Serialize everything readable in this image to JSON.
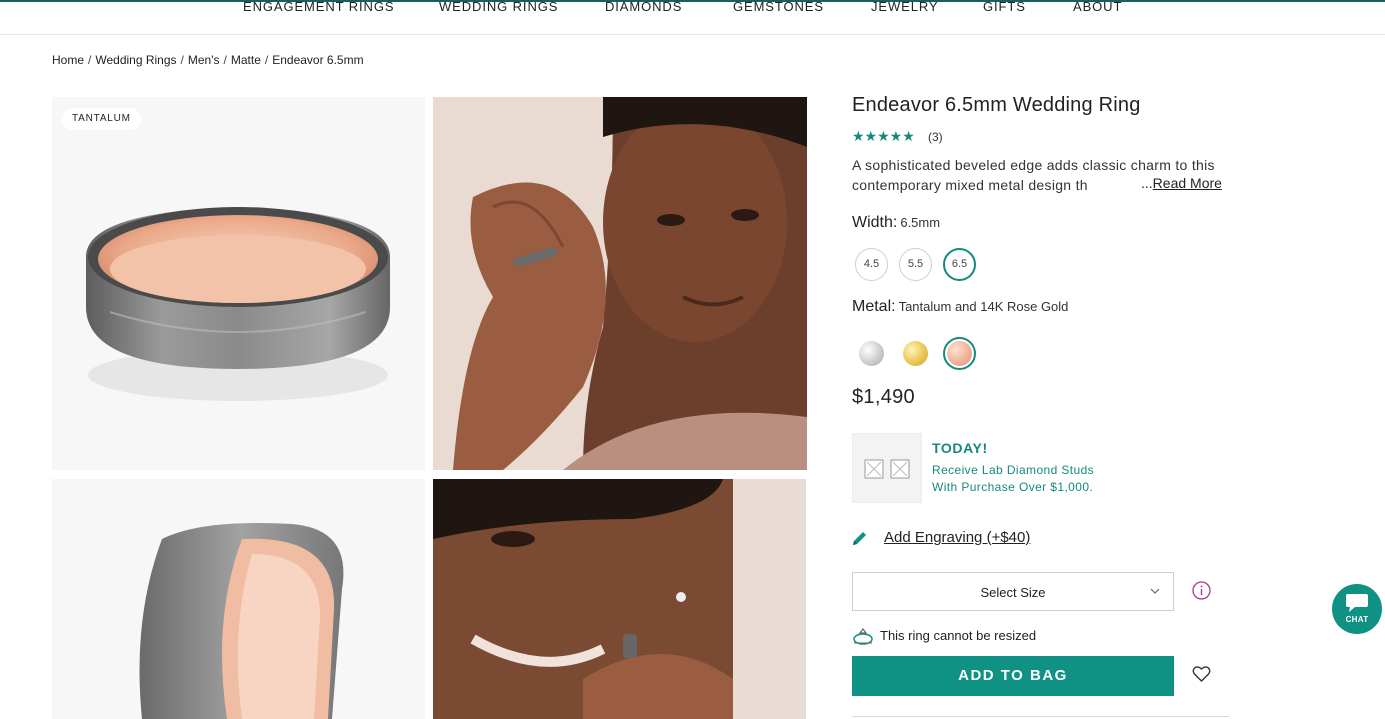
{
  "nav": {
    "items": [
      "Engagement Rings",
      "Wedding Rings",
      "Diamonds",
      "Gemstones",
      "Jewelry",
      "Gifts",
      "About"
    ]
  },
  "breadcrumb": [
    "Home",
    "Wedding Rings",
    "Men's",
    "Matte",
    "Endeavor 6.5mm"
  ],
  "gallery": {
    "badge": "TANTALUM"
  },
  "product": {
    "title": "Endeavor 6.5mm Wedding Ring",
    "stars": "★★★★★",
    "review_count": "(3)",
    "description": "A sophisticated beveled edge adds classic charm to this contemporary mixed metal design th",
    "read_more_prefix": "...",
    "read_more": "Read More",
    "width_label": "Width:",
    "width_value": "6.5mm",
    "width_options": [
      "4.5",
      "5.5",
      "6.5"
    ],
    "metal_label": "Metal:",
    "metal_value": "Tantalum and 14K Rose Gold",
    "metal_colors": [
      "#d9d9d9",
      "#e6c34c",
      "#efae93"
    ],
    "price": "$1,490"
  },
  "promo": {
    "title": "TODAY!",
    "line1": "Receive Lab Diamond Studs",
    "line2": "With Purchase Over $1,000."
  },
  "engraving": {
    "label": "Add Engraving (+$40)"
  },
  "size": {
    "placeholder": "Select Size"
  },
  "resize_note": "This ring cannot be resized",
  "add_to_bag": "ADD TO BAG",
  "chat": {
    "label": "CHAT"
  },
  "colors": {
    "accent": "#0f9184",
    "star": "#148a7d"
  }
}
